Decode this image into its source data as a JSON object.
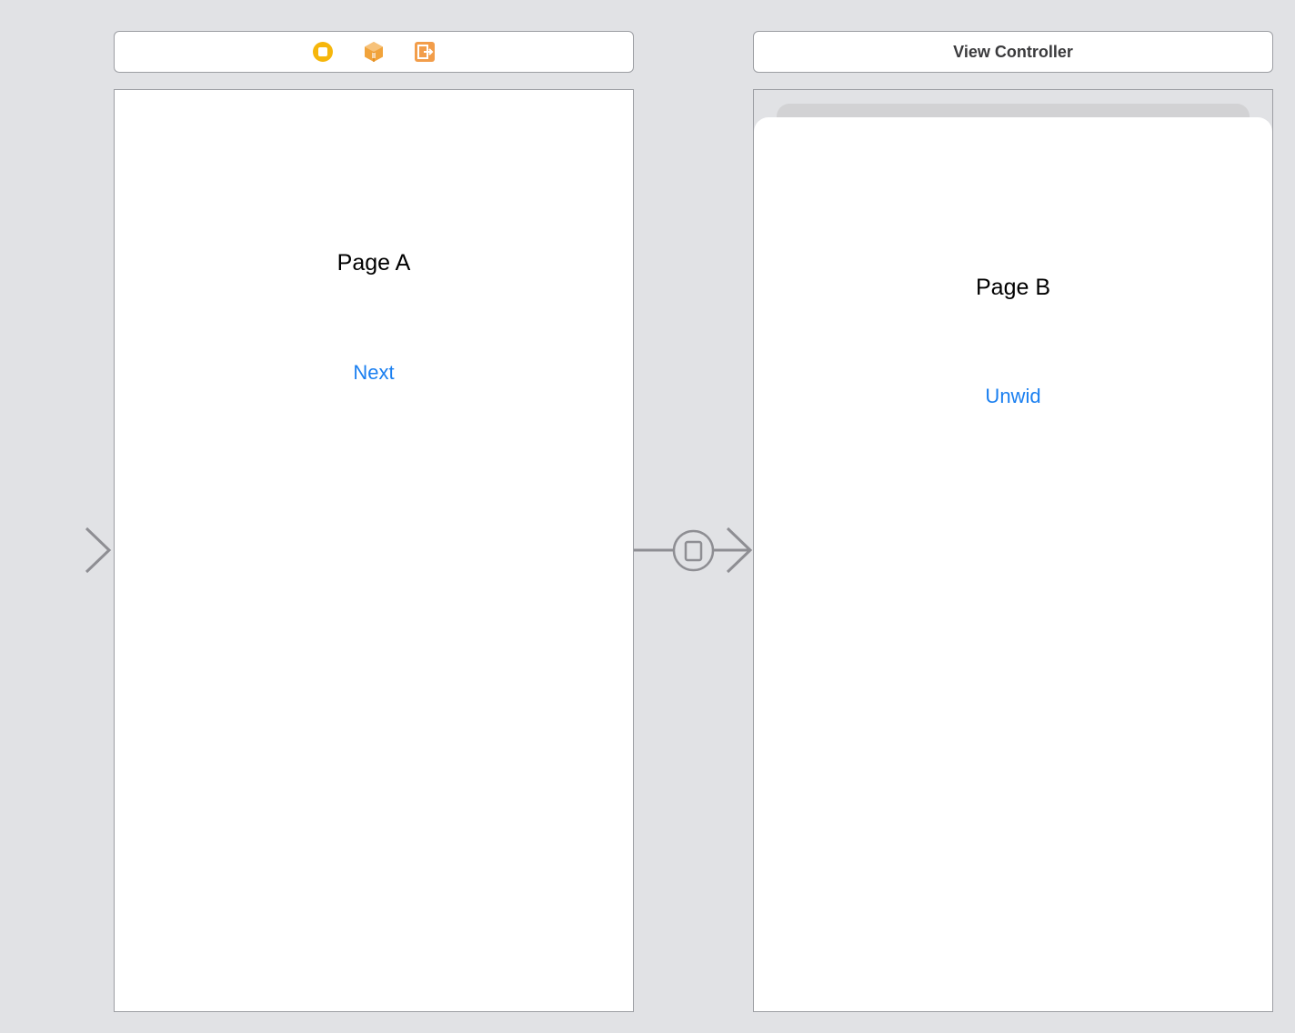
{
  "scene_a": {
    "dock_icons": [
      "view-controller-icon",
      "first-responder-icon",
      "exit-icon"
    ],
    "title": "Page A",
    "button_label": "Next"
  },
  "scene_b": {
    "header_title": "View Controller",
    "title": "Page B",
    "button_label": "Unwid"
  },
  "colors": {
    "canvas": "#e1e2e5",
    "border": "#9c9ea3",
    "link": "#1a7ff0",
    "view_controller_icon": "#f6b60b",
    "first_responder_icon": "#f1a33b",
    "exit_icon": "#f29d4a",
    "arrow": "#8e8e93"
  }
}
